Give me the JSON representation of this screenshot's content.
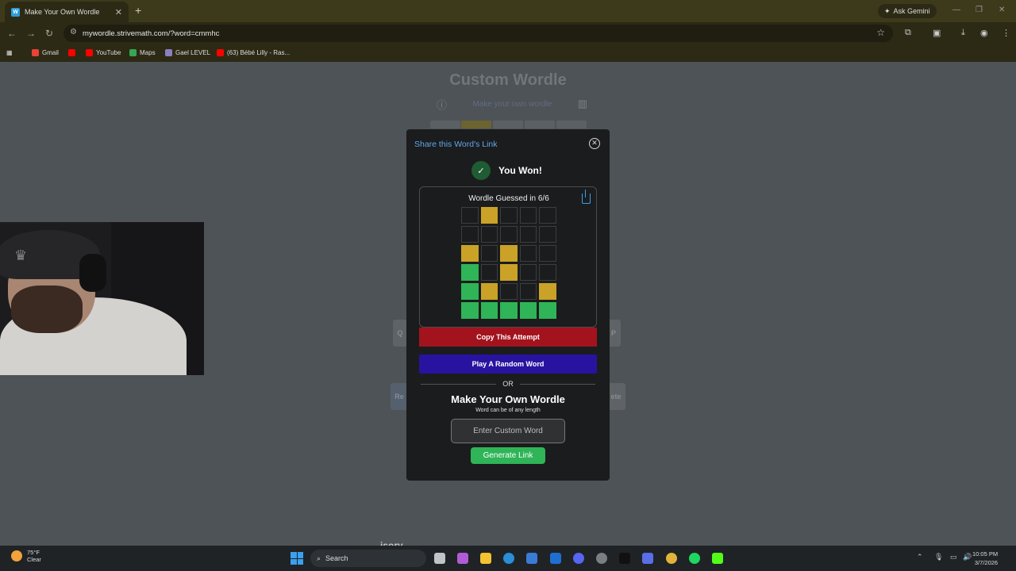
{
  "browser": {
    "tab_title": "Make Your Own Wordle",
    "favicon_letter": "W",
    "ask_gemini": "Ask Gemini",
    "url": "mywordle.strivemath.com/?word=cmmhc",
    "bookmarks": [
      "Gmail",
      "YouTube",
      "Maps",
      "Gael LEVEL",
      "(63) Bébé Lilly - Ras..."
    ]
  },
  "background_page": {
    "title": "Custom Wordle",
    "subtitle": "Make your own wordle",
    "key_left": "Q",
    "key_right": "P",
    "key_bottom_left": "Re",
    "key_bottom_right": "ete"
  },
  "modal": {
    "header": "Share this Word's Link",
    "won_text": "You Won!",
    "result_title": "Wordle Guessed in 6/6",
    "grid": [
      [
        "b",
        "y",
        "b",
        "b",
        "b"
      ],
      [
        "b",
        "b",
        "b",
        "b",
        "b"
      ],
      [
        "y",
        "b",
        "y",
        "b",
        "b"
      ],
      [
        "g",
        "b",
        "y",
        "b",
        "b"
      ],
      [
        "g",
        "y",
        "b",
        "b",
        "y"
      ],
      [
        "g",
        "g",
        "g",
        "g",
        "g"
      ]
    ],
    "copy_button": "Copy This Attempt",
    "random_button": "Play A Random Word",
    "or_text": "OR",
    "own_title": "Make Your Own Wordle",
    "own_subtitle": "Word can be of any length",
    "input_placeholder": "Enter Custom Word",
    "generate_button": "Generate Link"
  },
  "overlay_caption": "isory",
  "taskbar": {
    "temperature": "75°F",
    "condition": "Clear",
    "search_label": "Search",
    "time": "10:05 PM",
    "date": "3/7/2026"
  },
  "colors": {
    "yellow": "#c9a227",
    "green": "#2fb457",
    "copy_red": "#a3131d",
    "random_blue": "#2813a0"
  }
}
